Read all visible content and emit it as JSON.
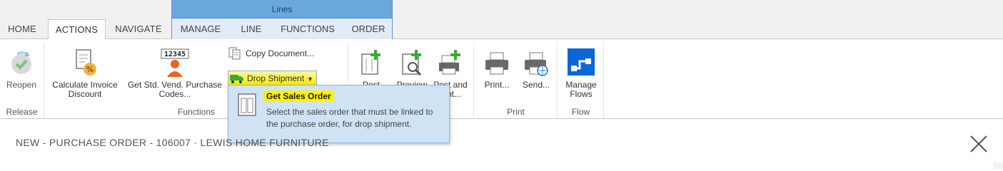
{
  "tabs": {
    "home": "HOME",
    "actions": "ACTIONS",
    "navigate": "NAVIGATE",
    "context_group": "Lines",
    "manage": "MANAGE",
    "line": "LINE",
    "functions": "FUNCTIONS",
    "order": "ORDER"
  },
  "ribbon": {
    "release": {
      "label": "Release",
      "reopen": "Reopen"
    },
    "functions": {
      "label": "Functions",
      "calc_invoice_discount": [
        "Calculate Invoice",
        "Discount"
      ],
      "get_std_vend_codes": [
        "Get Std. Vend. Purchase",
        "Codes..."
      ],
      "copy_document": "Copy Document...",
      "drop_shipment": "Drop Shipment"
    },
    "posting": {
      "post": "Post",
      "preview": "Preview",
      "post_and": "Post and",
      "post_and_sub": "...nt..."
    },
    "print": {
      "label": "Print",
      "print_btn": "Print...",
      "send_btn": "Send..."
    },
    "flow": {
      "label": "Flow",
      "manage_flows": [
        "Manage",
        "Flows"
      ]
    }
  },
  "tooltip": {
    "title": "Get Sales Order",
    "description": "Select the sales order that must be linked to the purchase order, for drop shipment."
  },
  "page": {
    "title": "NEW - PURCHASE ORDER - 106007 · LEWIS HOME FURNITURE"
  },
  "colors": {
    "context_header": "#6aa7dc",
    "highlight": "#fff200",
    "tooltip_bg": "#cfe3f5",
    "flow_icon": "#0a66d8",
    "accent_orange": "#e8622a",
    "accent_green": "#3aaa35"
  }
}
